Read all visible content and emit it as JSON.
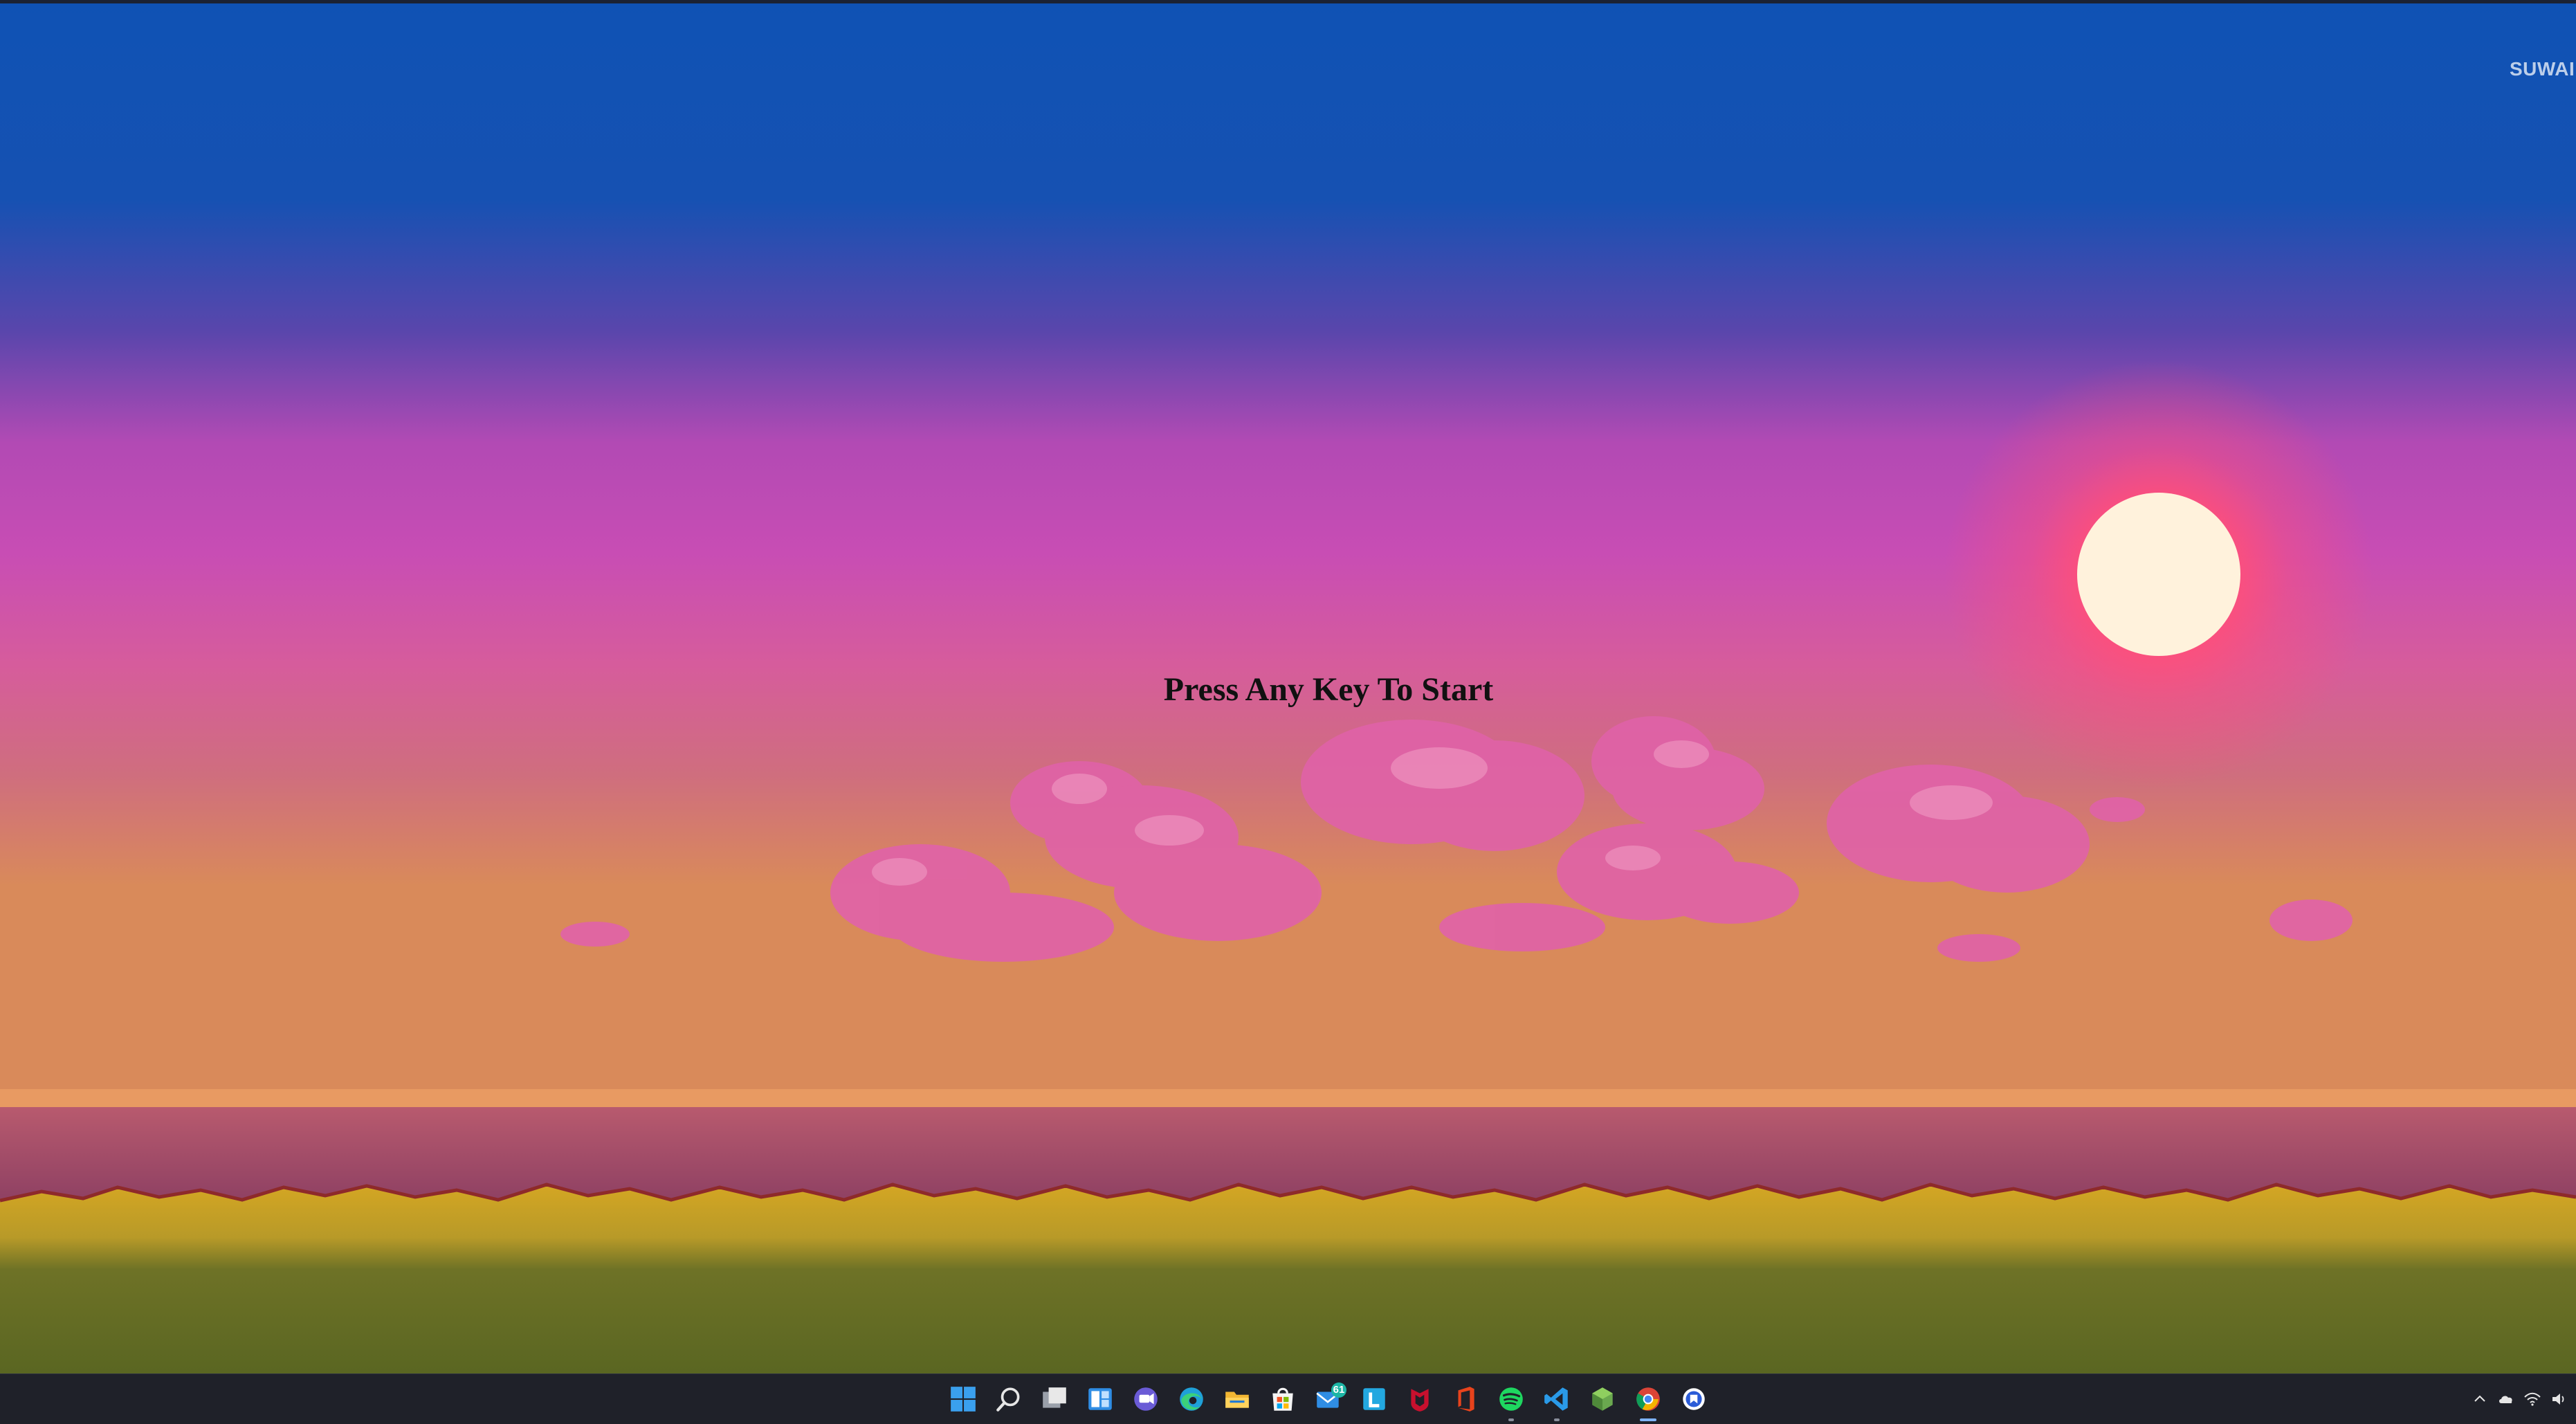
{
  "game": {
    "prompt": "Press Any Key To Start",
    "corner_text": "SUWAI",
    "colors": {
      "sky_top": "#0f52b4",
      "sky_mid": "#c84ab4",
      "sky_horizon": "#d98a5a",
      "sun": "#fff2dc",
      "sun_glow": "#ff4f7a",
      "cloud": "#e062a8",
      "cloud_highlight": "#ec8fbc",
      "water": "#a24a6a",
      "grass_top": "#d4a623",
      "grass_bottom": "#5c6a24"
    }
  },
  "taskbar": {
    "icons": [
      {
        "name": "start-icon",
        "label": "Start"
      },
      {
        "name": "search-icon",
        "label": "Search"
      },
      {
        "name": "task-view-icon",
        "label": "Task View"
      },
      {
        "name": "widgets-icon",
        "label": "Widgets"
      },
      {
        "name": "chat-icon",
        "label": "Chat"
      },
      {
        "name": "edge-icon",
        "label": "Microsoft Edge"
      },
      {
        "name": "file-explorer-icon",
        "label": "File Explorer"
      },
      {
        "name": "store-icon",
        "label": "Microsoft Store"
      },
      {
        "name": "mail-icon",
        "label": "Mail",
        "badge": "61"
      },
      {
        "name": "l-app-icon",
        "label": "L"
      },
      {
        "name": "mcafee-icon",
        "label": "McAfee"
      },
      {
        "name": "office-icon",
        "label": "Office"
      },
      {
        "name": "spotify-icon",
        "label": "Spotify"
      },
      {
        "name": "vscode-icon",
        "label": "Visual Studio Code"
      },
      {
        "name": "green-cube-icon",
        "label": "App"
      },
      {
        "name": "chrome-icon",
        "label": "Google Chrome"
      },
      {
        "name": "blue-circle-icon",
        "label": "App"
      }
    ],
    "tray": [
      {
        "name": "chevron-up-icon"
      },
      {
        "name": "cloud-icon"
      },
      {
        "name": "wifi-icon"
      },
      {
        "name": "speaker-icon"
      }
    ]
  }
}
